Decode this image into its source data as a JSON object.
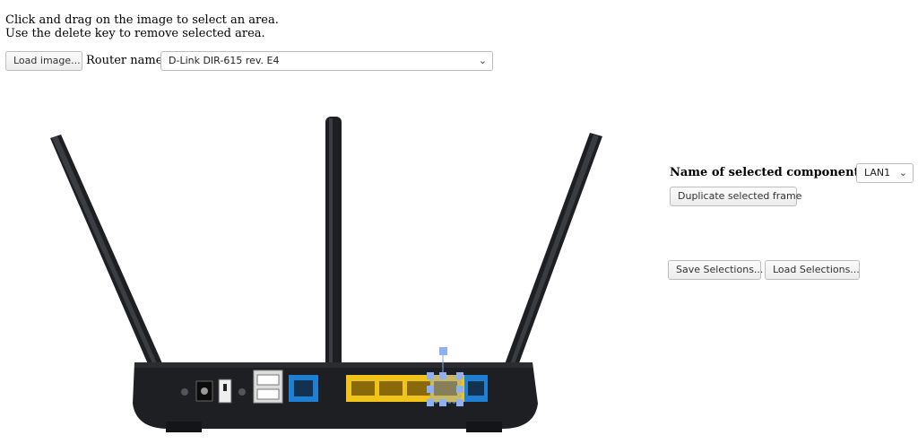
{
  "instructions": {
    "line1": "Click and drag on the image to select an area.",
    "line2": "Use the delete key to remove selected area."
  },
  "toolbar": {
    "load_image_label": "Load image...",
    "router_name_label": "Router name:",
    "router_name_value": "D-Link DIR-615 rev. E4"
  },
  "component": {
    "name_label": "Name of selected component:",
    "selected_value": "LAN1",
    "duplicate_label": "Duplicate selected frame"
  },
  "actions": {
    "save_label": "Save Selections...",
    "load_label": "Load Selections..."
  },
  "colors": {
    "router_body": "#1d1f22",
    "lan_yellow": "#f0c419",
    "wan_blue": "#1f7fd3",
    "selection": "#7fa7f0"
  }
}
